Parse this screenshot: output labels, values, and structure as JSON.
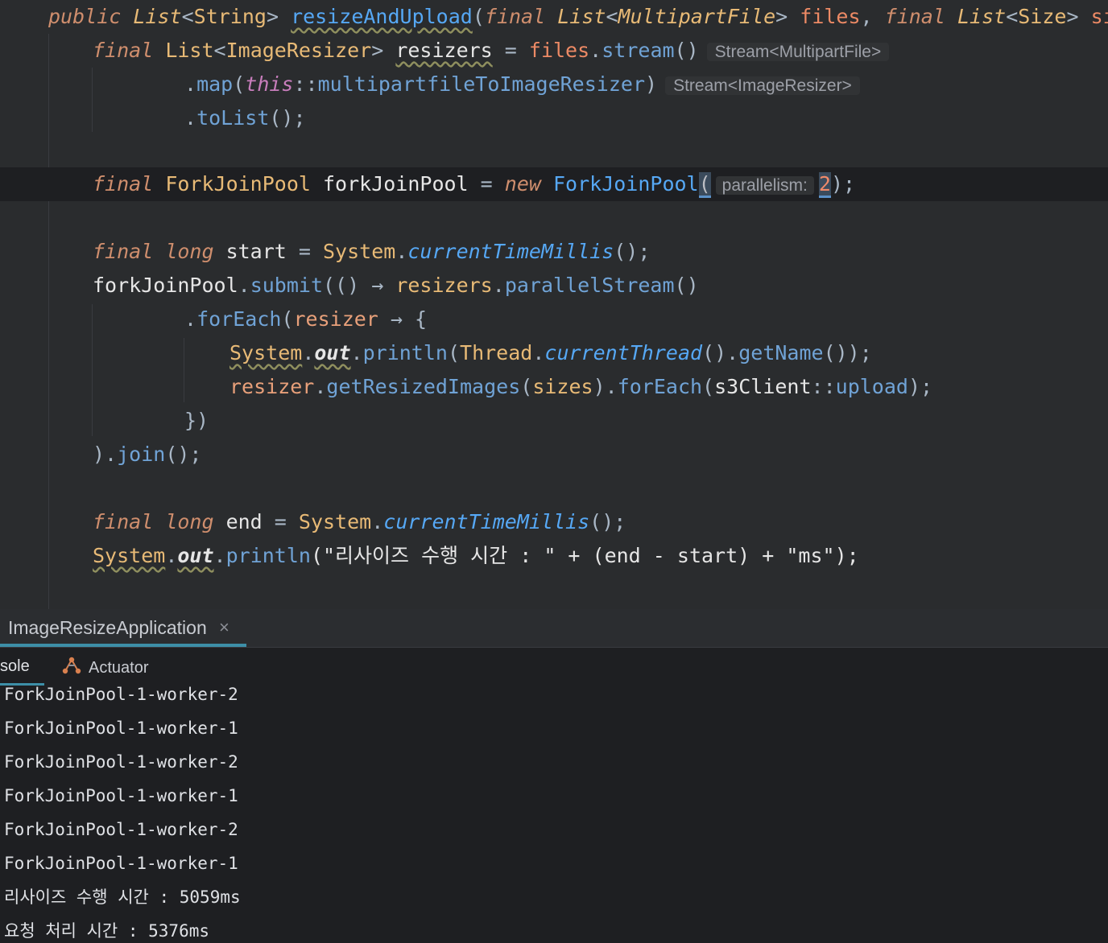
{
  "editor": {
    "hints": {
      "stream_multipart": "Stream<MultipartFile>",
      "stream_resizer": "Stream<ImageResizer>",
      "param_name": "parallelism:"
    },
    "lines": [
      [
        {
          "t": "public ",
          "c": "kw"
        },
        {
          "t": "List",
          "c": "ty-i"
        },
        {
          "t": "<",
          "c": "op"
        },
        {
          "t": "String",
          "c": "ty"
        },
        {
          "t": "> ",
          "c": "op"
        },
        {
          "t": "resizeAndUpload",
          "c": "fn uw"
        },
        {
          "t": "(",
          "c": "op"
        },
        {
          "t": "final ",
          "c": "kw"
        },
        {
          "t": "List",
          "c": "ty-i"
        },
        {
          "t": "<",
          "c": "op"
        },
        {
          "t": "MultipartFile",
          "c": "ty-i"
        },
        {
          "t": "> ",
          "c": "op"
        },
        {
          "t": "files",
          "c": "par"
        },
        {
          "t": ", ",
          "c": "op"
        },
        {
          "t": "final ",
          "c": "kw"
        },
        {
          "t": "List",
          "c": "ty-i"
        },
        {
          "t": "<",
          "c": "op"
        },
        {
          "t": "Size",
          "c": "ty"
        },
        {
          "t": "> ",
          "c": "op"
        },
        {
          "t": "sizes",
          "c": "par"
        },
        {
          "t": ") {",
          "c": "op"
        }
      ],
      [
        {
          "t": "final ",
          "c": "kw"
        },
        {
          "t": "List",
          "c": "ty"
        },
        {
          "t": "<",
          "c": "op"
        },
        {
          "t": "ImageResizer",
          "c": "ty"
        },
        {
          "t": "> ",
          "c": "op"
        },
        {
          "t": "resizers",
          "c": "plain uw"
        },
        {
          "t": " = ",
          "c": "op"
        },
        {
          "t": "files",
          "c": "par"
        },
        {
          "t": ".",
          "c": "op"
        },
        {
          "t": "stream",
          "c": "call"
        },
        {
          "t": "()",
          "c": "op"
        }
      ],
      [
        {
          "t": ".",
          "c": "op"
        },
        {
          "t": "map",
          "c": "call"
        },
        {
          "t": "(",
          "c": "op"
        },
        {
          "t": "this",
          "c": "fld ital"
        },
        {
          "t": "::",
          "c": "op"
        },
        {
          "t": "multipartfileToImageResizer",
          "c": "call"
        },
        {
          "t": ")",
          "c": "op"
        }
      ],
      [
        {
          "t": ".",
          "c": "op"
        },
        {
          "t": "toList",
          "c": "call"
        },
        {
          "t": "();",
          "c": "op"
        }
      ],
      [],
      [
        {
          "t": "final ",
          "c": "kw"
        },
        {
          "t": "ForkJoinPool ",
          "c": "ty"
        },
        {
          "t": "forkJoinPool",
          "c": "plain"
        },
        {
          "t": " = ",
          "c": "op"
        },
        {
          "t": "new ",
          "c": "kw"
        },
        {
          "t": "ForkJoinPool",
          "c": "fn"
        }
      ],
      [],
      [
        {
          "t": "final ",
          "c": "kw"
        },
        {
          "t": "long ",
          "c": "kw"
        },
        {
          "t": "start",
          "c": "plain"
        },
        {
          "t": " = ",
          "c": "op"
        },
        {
          "t": "System",
          "c": "ty"
        },
        {
          "t": ".",
          "c": "op"
        },
        {
          "t": "currentTimeMillis",
          "c": "fn-i"
        },
        {
          "t": "();",
          "c": "op"
        }
      ],
      [
        {
          "t": "forkJoinPool",
          "c": "plain"
        },
        {
          "t": ".",
          "c": "op"
        },
        {
          "t": "submit",
          "c": "call"
        },
        {
          "t": "(() ",
          "c": "op"
        },
        {
          "t": "→ ",
          "c": "op"
        },
        {
          "t": "resizers",
          "c": "ty"
        },
        {
          "t": ".",
          "c": "op"
        },
        {
          "t": "parallelStream",
          "c": "call"
        },
        {
          "t": "()",
          "c": "op"
        }
      ],
      [
        {
          "t": ".",
          "c": "op"
        },
        {
          "t": "forEach",
          "c": "call"
        },
        {
          "t": "(",
          "c": "op"
        },
        {
          "t": "resizer",
          "c": "local"
        },
        {
          "t": " → {",
          "c": "op"
        }
      ],
      [
        {
          "t": "System",
          "c": "ty uw"
        },
        {
          "t": ".",
          "c": "op"
        },
        {
          "t": "out",
          "c": "plain ital bold uw"
        },
        {
          "t": ".",
          "c": "op"
        },
        {
          "t": "println",
          "c": "call"
        },
        {
          "t": "(",
          "c": "op"
        },
        {
          "t": "Thread",
          "c": "ty"
        },
        {
          "t": ".",
          "c": "op"
        },
        {
          "t": "currentThread",
          "c": "fn-i"
        },
        {
          "t": "().",
          "c": "op"
        },
        {
          "t": "getName",
          "c": "call"
        },
        {
          "t": "());",
          "c": "op"
        }
      ],
      [
        {
          "t": "resizer",
          "c": "local"
        },
        {
          "t": ".",
          "c": "op"
        },
        {
          "t": "getResizedImages",
          "c": "call"
        },
        {
          "t": "(",
          "c": "op"
        },
        {
          "t": "sizes",
          "c": "ty"
        },
        {
          "t": ").",
          "c": "op"
        },
        {
          "t": "forEach",
          "c": "call"
        },
        {
          "t": "(",
          "c": "op"
        },
        {
          "t": "s3Client",
          "c": "plain"
        },
        {
          "t": "::",
          "c": "op"
        },
        {
          "t": "upload",
          "c": "call"
        },
        {
          "t": ");",
          "c": "op"
        }
      ],
      [
        {
          "t": "})",
          "c": "op"
        }
      ],
      [
        {
          "t": ").",
          "c": "op"
        },
        {
          "t": "join",
          "c": "call"
        },
        {
          "t": "();",
          "c": "op"
        }
      ],
      [],
      [
        {
          "t": "final ",
          "c": "kw"
        },
        {
          "t": "long ",
          "c": "kw"
        },
        {
          "t": "end",
          "c": "plain"
        },
        {
          "t": " = ",
          "c": "op"
        },
        {
          "t": "System",
          "c": "ty"
        },
        {
          "t": ".",
          "c": "op"
        },
        {
          "t": "currentTimeMillis",
          "c": "fn-i"
        },
        {
          "t": "();",
          "c": "op"
        }
      ],
      [
        {
          "t": "System",
          "c": "ty uw"
        },
        {
          "t": ".",
          "c": "op"
        },
        {
          "t": "out",
          "c": "plain ital bold uw"
        },
        {
          "t": ".",
          "c": "op"
        },
        {
          "t": "println",
          "c": "call"
        },
        {
          "t": "(\"리사이즈 수행 시간 : \" + (",
          "c": "plain"
        },
        {
          "t": "end",
          "c": "plain"
        },
        {
          "t": " - ",
          "c": "plain"
        },
        {
          "t": "start",
          "c": "plain"
        },
        {
          "t": ") + \"ms\");",
          "c": "plain"
        }
      ]
    ],
    "line5_tail": {
      "open": "(",
      "value": "2",
      "close": ");"
    }
  },
  "toolwindow": {
    "run_tab": "ImageResizeApplication",
    "close_glyph": "×",
    "tabs": {
      "console": "sole",
      "actuator": "Actuator"
    }
  },
  "console": {
    "lines": [
      "ForkJoinPool-1-worker-2",
      "ForkJoinPool-1-worker-1",
      "ForkJoinPool-1-worker-2",
      "ForkJoinPool-1-worker-1",
      "ForkJoinPool-1-worker-2",
      "ForkJoinPool-1-worker-1",
      "리사이즈 수행 시간 : 5059ms",
      "요청 처리 시간 : 5376ms"
    ]
  },
  "colors": {
    "editor_bg": "#2a2c2e",
    "console_bg": "#1e1f22",
    "keyword": "#cf8e6d",
    "type": "#e8ba76",
    "method": "#56a8f5",
    "accent": "#3d8fa8"
  }
}
